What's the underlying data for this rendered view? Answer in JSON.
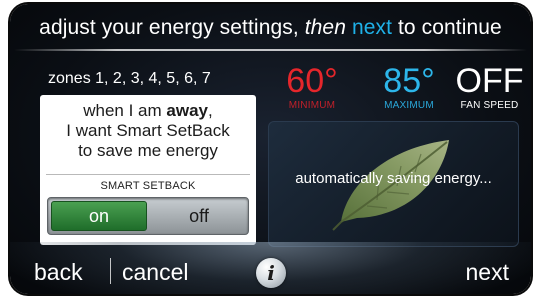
{
  "header": {
    "prefix": "adjust your energy settings, ",
    "italic": "then",
    "middle": " ",
    "accent_word": "next",
    "suffix": " to continue"
  },
  "zones_label": "zones 1, 2, 3, 4, 5, 6, 7",
  "readings": {
    "minimum": {
      "value": "60°",
      "label": "MINIMUM",
      "color": "#e5262b"
    },
    "maximum": {
      "value": "85°",
      "label": "MAXIMUM",
      "color": "#2db6ea"
    },
    "fan": {
      "value": "OFF",
      "label": "FAN SPEED",
      "color": "#ffffff"
    }
  },
  "card": {
    "line1_prefix": "when I am ",
    "line1_bold": "away",
    "line1_suffix": ",",
    "line2": "I want Smart SetBack",
    "line3": "to save me energy",
    "setting_label": "SMART SETBACK",
    "toggle": {
      "on_label": "on",
      "off_label": "off",
      "selected": "on",
      "on_color": "#2f8a3b"
    }
  },
  "panel": {
    "text": "automatically saving energy...",
    "icon": "leaf-icon"
  },
  "footer": {
    "back_label": "back",
    "cancel_label": "cancel",
    "info_label": "i",
    "next_label": "next"
  }
}
